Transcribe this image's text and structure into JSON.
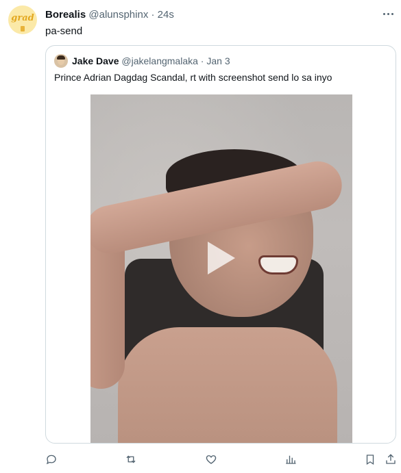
{
  "tweet": {
    "display_name": "Borealis",
    "handle": "@alunsphinx",
    "separator": "·",
    "timestamp": "24s",
    "text": "pa-send",
    "avatar_text": "grad"
  },
  "quoted_tweet": {
    "display_name": "Jake Dave",
    "handle": "@jakelangmalaka",
    "separator": "·",
    "timestamp": "Jan 3",
    "text": "Prince Adrian Dagdag Scandal, rt with screenshot send lo sa inyo"
  },
  "actions": [
    {
      "icon": "reply-icon"
    },
    {
      "icon": "retweet-icon"
    },
    {
      "icon": "like-icon"
    },
    {
      "icon": "views-icon"
    },
    {
      "icon": "bookmark-icon"
    },
    {
      "icon": "share-icon"
    }
  ],
  "colors": {
    "text_primary": "#0f1419",
    "text_secondary": "#536471",
    "border": "#cfd9de"
  }
}
